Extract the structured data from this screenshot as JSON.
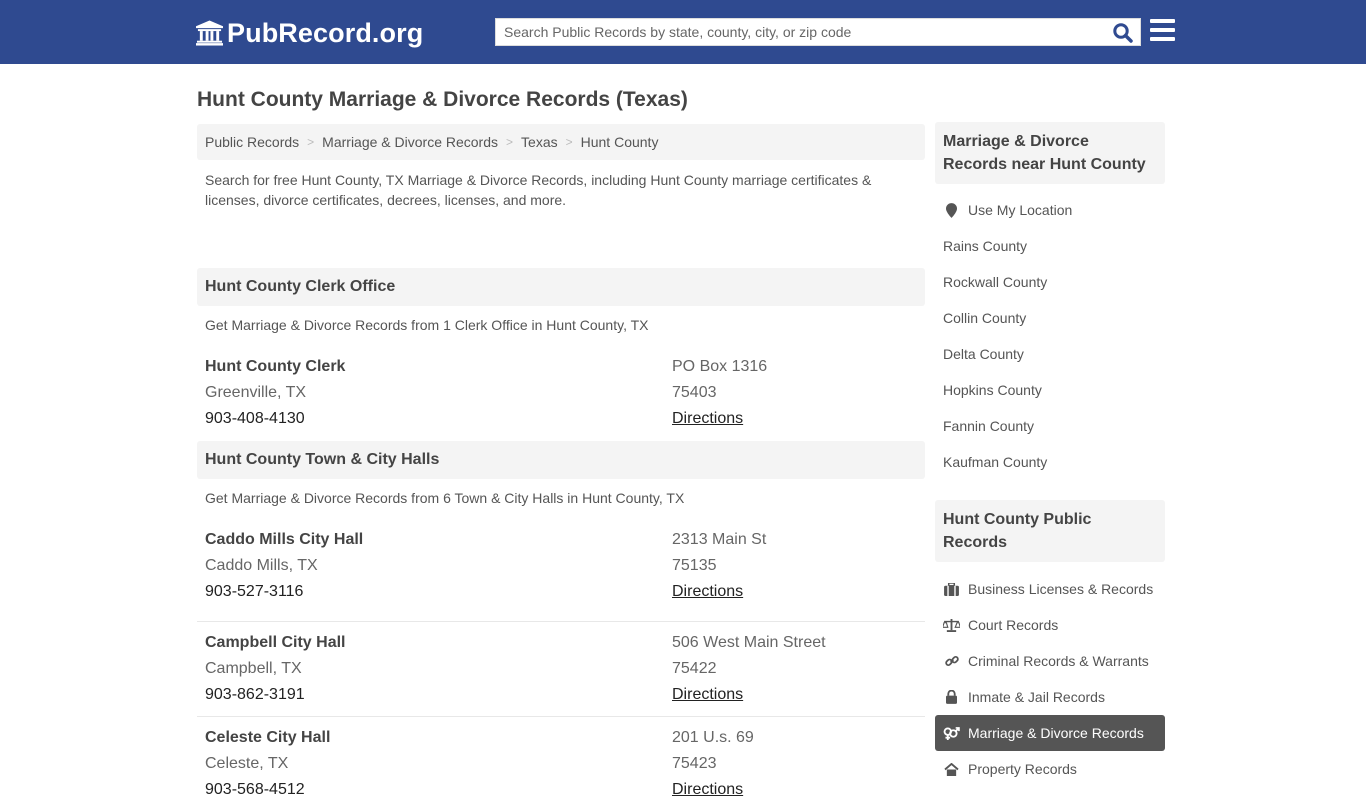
{
  "header": {
    "logo_text": "PubRecord.org",
    "search_placeholder": "Search Public Records by state, county, city, or zip code",
    "search_value": ""
  },
  "page": {
    "title": "Hunt County Marriage & Divorce Records (Texas)",
    "breadcrumb": [
      "Public Records",
      "Marriage & Divorce Records",
      "Texas",
      "Hunt County"
    ],
    "intro": "Search for free Hunt County, TX Marriage & Divorce Records, including Hunt County marriage certificates & licenses, divorce certificates, decrees, licenses, and more."
  },
  "sections": [
    {
      "title": "Hunt County Clerk Office",
      "subtitle": "Get Marriage & Divorce Records from 1 Clerk Office in Hunt County, TX",
      "listings": [
        {
          "name": "Hunt County Clerk",
          "city": "Greenville, TX",
          "phone": "903-408-4130",
          "address": "PO Box 1316",
          "zip": "75403",
          "link": "Directions"
        }
      ]
    },
    {
      "title": "Hunt County Town & City Halls",
      "subtitle": "Get Marriage & Divorce Records from 6 Town & City Halls in Hunt County, TX",
      "listings": [
        {
          "name": "Caddo Mills City Hall",
          "city": "Caddo Mills, TX",
          "phone": "903-527-3116",
          "address": "2313 Main St",
          "zip": "75135",
          "link": "Directions"
        },
        {
          "name": "Campbell City Hall",
          "city": "Campbell, TX",
          "phone": "903-862-3191",
          "address": "506 West Main Street",
          "zip": "75422",
          "link": "Directions"
        },
        {
          "name": "Celeste City Hall",
          "city": "Celeste, TX",
          "phone": "903-568-4512",
          "address": "201 U.s. 69",
          "zip": "75423",
          "link": "Directions"
        }
      ]
    }
  ],
  "sidebar": {
    "nearby_title": "Marriage & Divorce Records near Hunt County",
    "use_location": "Use My Location",
    "nearby": [
      "Rains County",
      "Rockwall County",
      "Collin County",
      "Delta County",
      "Hopkins County",
      "Fannin County",
      "Kaufman County"
    ],
    "public_title": "Hunt County Public Records",
    "public_records": [
      {
        "label": "Business Licenses & Records",
        "icon": "briefcase-icon"
      },
      {
        "label": "Court Records",
        "icon": "scales-icon"
      },
      {
        "label": "Criminal Records & Warrants",
        "icon": "link-icon"
      },
      {
        "label": "Inmate & Jail Records",
        "icon": "lock-icon"
      },
      {
        "label": "Marriage & Divorce Records",
        "icon": "gender-icon",
        "active": true
      },
      {
        "label": "Property Records",
        "icon": "home-icon"
      }
    ]
  },
  "colors": {
    "header_bg": "#2f4a90",
    "search_icon": "#2f4a90",
    "active_item_bg": "#555555"
  }
}
